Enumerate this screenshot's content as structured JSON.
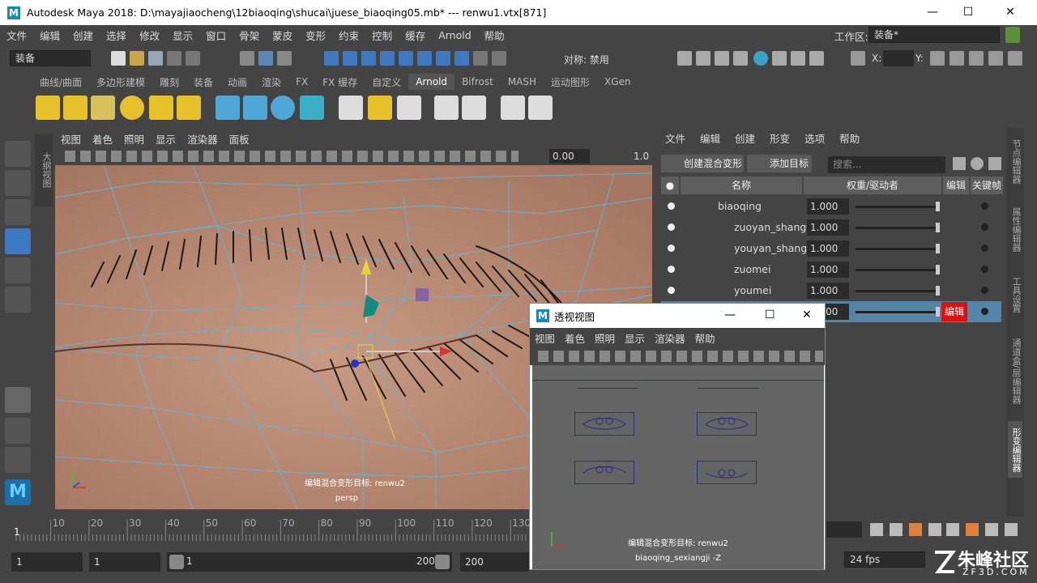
{
  "window": {
    "title": "Autodesk Maya 2018: D:\\mayajiaocheng\\12biaoqing\\shucai\\juese_biaoqing05.mb*   ---   renwu1.vtx[871]",
    "minimize": "—",
    "maximize": "☐",
    "close": "✕"
  },
  "menubar": {
    "items": [
      "文件",
      "编辑",
      "创建",
      "选择",
      "修改",
      "显示",
      "窗口",
      "骨架",
      "蒙皮",
      "变形",
      "约束",
      "控制",
      "缓存",
      "Arnold",
      "帮助"
    ],
    "workspace_label": "工作区:",
    "workspace_value": "装备*"
  },
  "statusline": {
    "mode": "装备",
    "symmetry": "对称: 禁用",
    "x_label": "X:",
    "y_label": "Y:"
  },
  "shelf_tabs": [
    "曲线/曲面",
    "多边形建模",
    "雕刻",
    "装备",
    "动画",
    "渲染",
    "FX",
    "FX 缓存",
    "自定义",
    "Arnold",
    "Bifrost",
    "MASH",
    "运动图形",
    "XGen"
  ],
  "shelf_active": "Arnold",
  "sidebar_label": "大纲视图",
  "viewport": {
    "menu": [
      "视图",
      "着色",
      "照明",
      "显示",
      "渲染器",
      "面板"
    ],
    "toolbar_value": "0.00",
    "toolbar_value2": "1.0",
    "caption": "编辑混合变形目标: renwu2",
    "camera": "persp"
  },
  "shape_editor": {
    "menu": [
      "文件",
      "编辑",
      "创建",
      "形变",
      "选项",
      "帮助"
    ],
    "create_blend": "创建混合变形",
    "add_target": "添加目标",
    "search_placeholder": "搜索...",
    "columns": {
      "name": "名称",
      "weight": "权重/驱动者",
      "edit": "编辑",
      "key": "关键帧"
    },
    "rows": [
      {
        "name": "biaoqing",
        "weight": "1.000"
      },
      {
        "name": "zuoyan_shangyan",
        "weight": "1.000"
      },
      {
        "name": "youyan_shangyan",
        "weight": "1.000"
      },
      {
        "name": "zuomei",
        "weight": "1.000"
      },
      {
        "name": "youmei",
        "weight": "1.000"
      },
      {
        "name": "",
        "weight": "1.000",
        "edit": "编辑"
      }
    ]
  },
  "right_tabs": [
    "节点编辑器",
    "属性编辑器",
    "工具设置",
    "通道盒/层编辑器",
    "形变编辑器"
  ],
  "timeline": {
    "ticks": [
      "10",
      "20",
      "30",
      "40",
      "50",
      "60",
      "70",
      "80",
      "90",
      "100",
      "110",
      "120",
      "130"
    ],
    "current": "1"
  },
  "range": {
    "start": "1",
    "anim_start": "1",
    "range_start": "1",
    "range_end": "200",
    "end": "200",
    "fps": "24 fps"
  },
  "popup": {
    "title": "透视视图",
    "menu": [
      "视图",
      "着色",
      "照明",
      "显示",
      "渲染器",
      "帮助"
    ],
    "caption": "编辑混合变形目标: renwu2",
    "camera": "biaoqing_sexiangji -Z",
    "min": "—",
    "max": "☐",
    "close": "✕"
  },
  "watermark": {
    "brand": "朱峰社区",
    "site": "ZF3D.COM"
  }
}
